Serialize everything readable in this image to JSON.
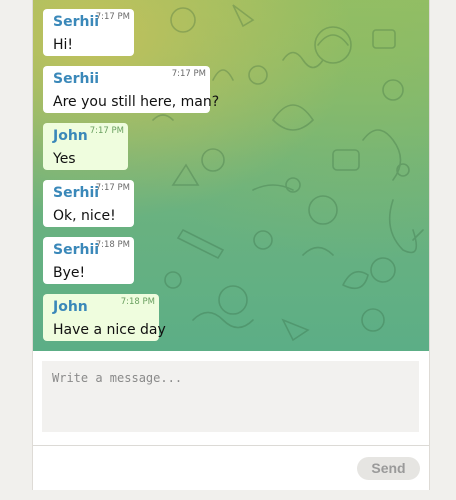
{
  "messages": [
    {
      "sender": "Serhii",
      "time": "7:17 PM",
      "text": "Hi!",
      "own": false
    },
    {
      "sender": "Serhii",
      "time": "7:17 PM",
      "text": "Are you still here, man?",
      "own": false
    },
    {
      "sender": "John",
      "time": "7:17 PM",
      "text": "Yes",
      "own": true
    },
    {
      "sender": "Serhii",
      "time": "7:17 PM",
      "text": "Ok, nice!",
      "own": false
    },
    {
      "sender": "Serhii",
      "time": "7:18 PM",
      "text": "Bye!",
      "own": false
    },
    {
      "sender": "John",
      "time": "7:18 PM",
      "text": "Have a nice day",
      "own": true
    }
  ],
  "composer": {
    "placeholder": "Write a message...",
    "value": "",
    "send_label": "Send"
  },
  "colors": {
    "sender_name": "#3a88b9",
    "own_bubble": "#effdde",
    "other_bubble": "#ffffff",
    "background_top": "#8fbd6b",
    "background_bottom": "#5cae86"
  },
  "icons": [
    "doodle-pattern-background"
  ]
}
